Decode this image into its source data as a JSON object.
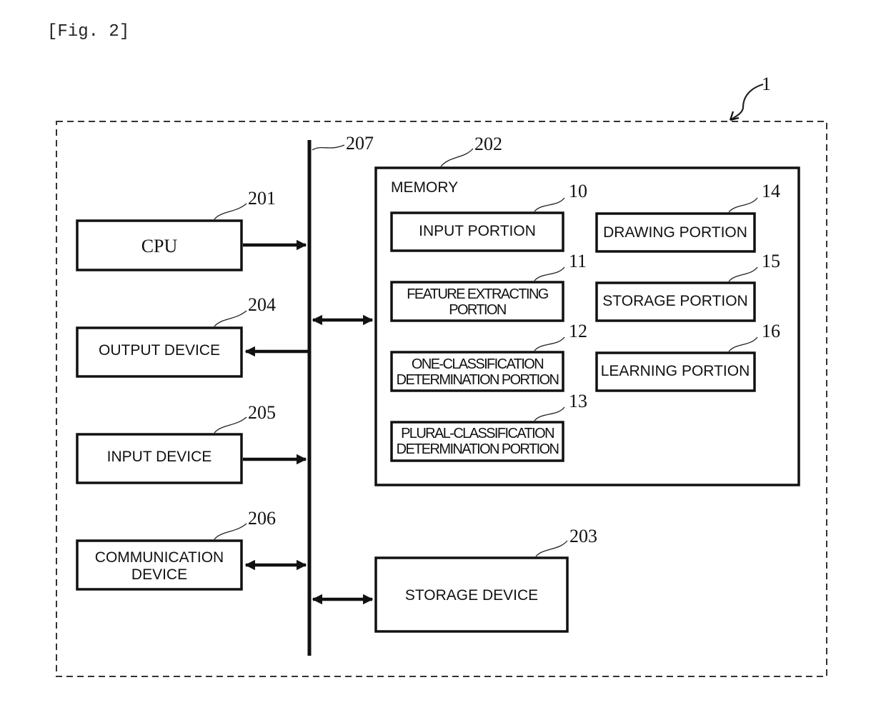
{
  "figure": {
    "title": "[Fig. 2]",
    "system_ref": "1",
    "bus_ref": "207"
  },
  "left_devices": [
    {
      "ref": "201",
      "label": "CPU",
      "arrow": "to-bus"
    },
    {
      "ref": "204",
      "label": "OUTPUT DEVICE",
      "arrow": "from-bus"
    },
    {
      "ref": "205",
      "label": "INPUT DEVICE",
      "arrow": "to-bus"
    },
    {
      "ref": "206",
      "label_lines": [
        "COMMUNICATION",
        "DEVICE"
      ],
      "arrow": "bidirectional"
    }
  ],
  "memory": {
    "ref": "202",
    "label": "MEMORY",
    "arrow": "bidirectional",
    "portions": [
      {
        "ref": "10",
        "label_lines": [
          "INPUT PORTION"
        ]
      },
      {
        "ref": "11",
        "label_lines": [
          "FEATURE EXTRACTING",
          "PORTION"
        ]
      },
      {
        "ref": "12",
        "label_lines": [
          "ONE-CLASSIFICATION",
          "DETERMINATION PORTION"
        ]
      },
      {
        "ref": "13",
        "label_lines": [
          "PLURAL-CLASSIFICATION",
          "DETERMINATION PORTION"
        ]
      },
      {
        "ref": "14",
        "label_lines": [
          "DRAWING PORTION"
        ]
      },
      {
        "ref": "15",
        "label_lines": [
          "STORAGE PORTION"
        ]
      },
      {
        "ref": "16",
        "label_lines": [
          "LEARNING PORTION"
        ]
      }
    ]
  },
  "storage_device": {
    "ref": "203",
    "label": "STORAGE DEVICE",
    "arrow": "bidirectional"
  }
}
